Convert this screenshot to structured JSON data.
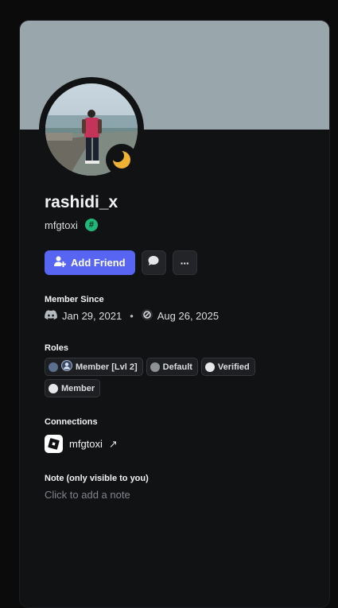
{
  "profile": {
    "display_name": "rashidi_x",
    "username": "mfgtoxi",
    "tag_badge_glyph": "#",
    "banner_color": "#99a6ab",
    "status": "idle-moon-icon"
  },
  "actions": {
    "add_friend_label": "Add Friend",
    "more_glyph": "···"
  },
  "member_since": {
    "label": "Member Since",
    "discord_date": "Jan 29, 2021",
    "separator": "•",
    "server_date": "Aug 26, 2025"
  },
  "roles": {
    "label": "Roles",
    "items": [
      {
        "name": "Member [Lvl 2]",
        "color": "#5b6f91"
      },
      {
        "name": "Default",
        "color": "#8e9297"
      },
      {
        "name": "Verified",
        "color": "#e6e7e8"
      },
      {
        "name": "Member",
        "color": "#e6e7e8"
      }
    ]
  },
  "connections": {
    "label": "Connections",
    "items": [
      {
        "service": "roblox-icon",
        "name": "mfgtoxi",
        "link_glyph": "↗"
      }
    ]
  },
  "note": {
    "label": "Note (only visible to you)",
    "placeholder": "Click to add a note"
  },
  "colors": {
    "accent": "#5865f2",
    "card_bg": "#111214",
    "tag_green": "#1fb97a"
  }
}
